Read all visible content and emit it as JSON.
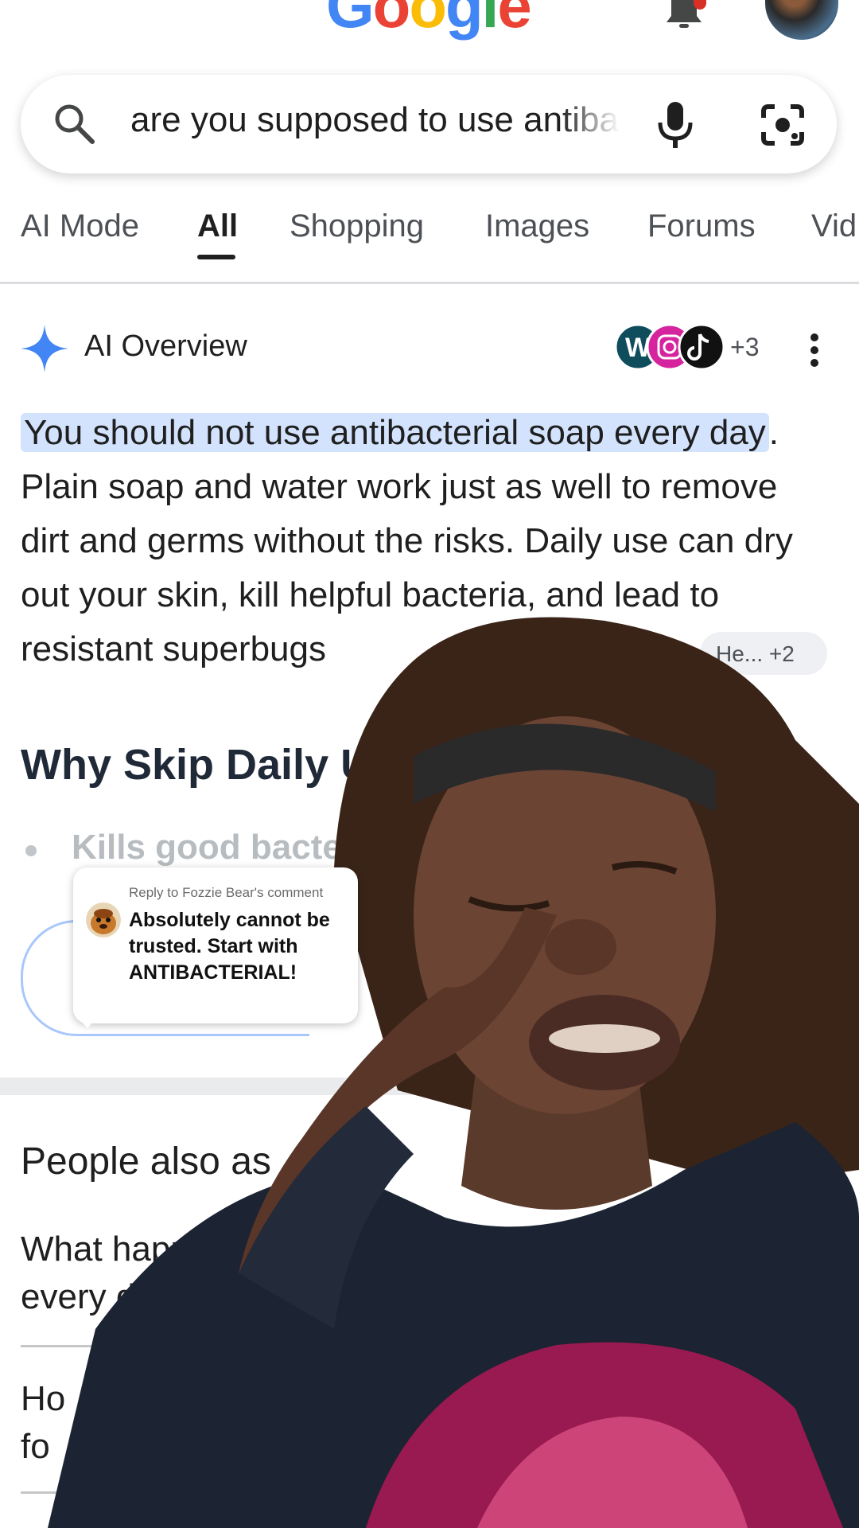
{
  "header": {
    "logo_letters": [
      {
        "char": "G",
        "color": "#4285f4"
      },
      {
        "char": "o",
        "color": "#ea4335"
      },
      {
        "char": "o",
        "color": "#fbbc05"
      },
      {
        "char": "g",
        "color": "#4285f4"
      },
      {
        "char": "l",
        "color": "#34a853"
      },
      {
        "char": "e",
        "color": "#ea4335"
      }
    ],
    "icons": [
      "bell-icon",
      "avatar"
    ]
  },
  "search": {
    "query": "are you supposed to use antibacterial soap every day",
    "icons": [
      "search-icon",
      "mic-icon",
      "lens-icon"
    ]
  },
  "tabs": [
    {
      "label": "AI Mode",
      "active": false
    },
    {
      "label": "All",
      "active": true
    },
    {
      "label": "Shopping",
      "active": false
    },
    {
      "label": "Images",
      "active": false
    },
    {
      "label": "Forums",
      "active": false
    },
    {
      "label": "Vid",
      "active": false
    }
  ],
  "ai_overview": {
    "title": "AI Overview",
    "sources_more": "+3",
    "highlight": "You should not use antibacterial soap every day",
    "rest": ". Plain soap and water work just as well to remove dirt and germs without the risks. Daily use can dry out your skin, kill helpful bacteria, and lead to resistant superbugs",
    "chip": "He...  +2",
    "section_heading": "Why Skip Daily U",
    "bullet": "Kills good bacte"
  },
  "people_also_ask": {
    "heading": "People also as",
    "questions": [
      {
        "line1": "What happe",
        "line2": "every day"
      },
      {
        "line1": "Ho",
        "line2": "fo"
      }
    ]
  },
  "reply_bubble": {
    "reply_to": "Reply to Fozzie Bear's comment",
    "text": "Absolutely cannot be trusted. Start with ANTIBACTERIAL!"
  },
  "colors": {
    "highlight_bg": "#d3e3fd",
    "accent_blue": "#4285f4"
  }
}
